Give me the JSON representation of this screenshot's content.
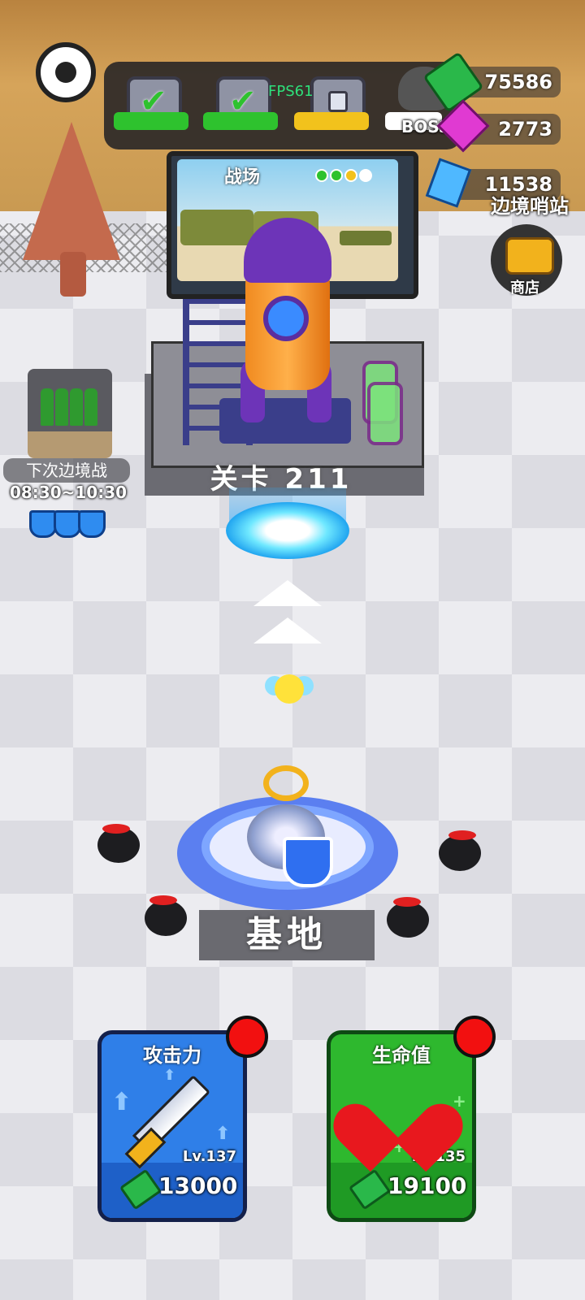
{
  "hud": {
    "fps": "FPS61",
    "boss_label": "BOSS",
    "chests": [
      {
        "state": "completed",
        "bar_color": "#2ec22e"
      },
      {
        "state": "completed",
        "bar_color": "#2ec22e"
      },
      {
        "state": "locked",
        "bar_color": "#f2c21c"
      }
    ],
    "boss_bar_color": "#ffffff"
  },
  "currency": {
    "cash": "75586",
    "gems": "2773",
    "crystals": "11538"
  },
  "side": {
    "border_outpost_label": "边境哨站",
    "shop_label": "商店",
    "next_border_war_label": "下次边境战",
    "border_war_time": "08:30~10:30",
    "shield_count": 3
  },
  "stage": {
    "screen_title": "战场",
    "screen_dots": [
      "#2ec22e",
      "#2ec22e",
      "#f2c21c",
      "#ffffff"
    ],
    "level_label": "关卡 211"
  },
  "base": {
    "label": "基地"
  },
  "upgrades": {
    "attack": {
      "title": "攻击力",
      "level": "Lv.137",
      "price": "13000",
      "color": "#2f7fe8"
    },
    "health": {
      "title": "生命值",
      "level": "Lv.135",
      "price": "19100",
      "color": "#2eb82e"
    }
  }
}
